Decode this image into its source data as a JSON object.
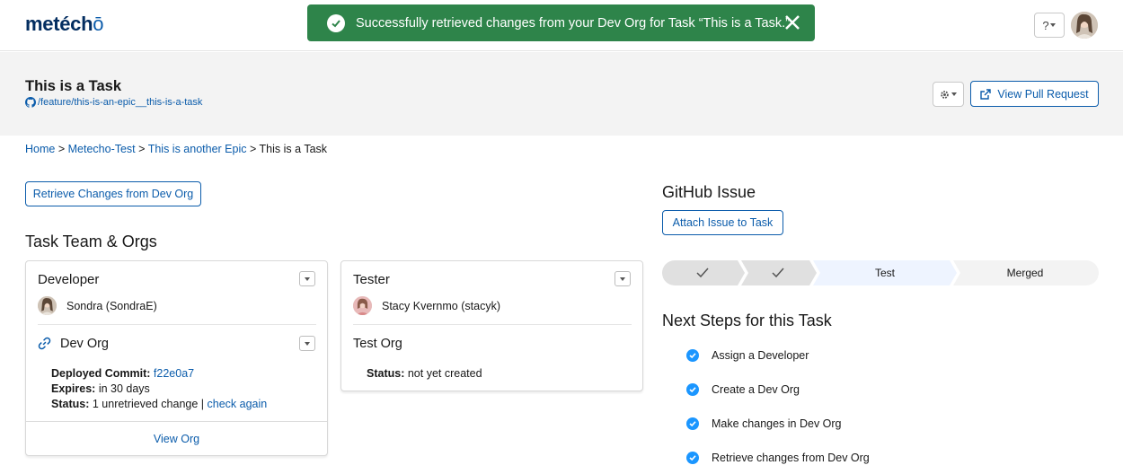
{
  "app": {
    "logo": "metecho"
  },
  "toast": {
    "message": "Successfully retrieved changes from your Dev Org for Task “This is a Task.”",
    "color": "#2e844a"
  },
  "header": {
    "help_label": "?",
    "title": "This is a Task",
    "branch": "/feature/this-is-an-epic__this-is-a-task",
    "view_pr_label": "View Pull Request"
  },
  "breadcrumb": {
    "home": "Home",
    "project": "Metecho-Test",
    "epic": "This is another Epic",
    "current": "This is a Task",
    "separator": ">"
  },
  "actions": {
    "retrieve_label": "Retrieve Changes from Dev Org"
  },
  "team": {
    "heading": "Task Team & Orgs",
    "developer": {
      "role": "Developer",
      "user": "Sondra (SondraE)",
      "org_title": "Dev Org",
      "commit_label": "Deployed Commit:",
      "commit": "f22e0a7",
      "expires_label": "Expires:",
      "expires": "in 30 days",
      "status_label": "Status:",
      "status": "1 unretrieved change |",
      "check_again": "check again",
      "view_org": "View Org"
    },
    "tester": {
      "role": "Tester",
      "user": "Stacy Kvernmo (stacyk)",
      "org_title": "Test Org",
      "status_label": "Status:",
      "status": "not yet created"
    }
  },
  "github": {
    "heading": "GitHub Issue",
    "attach_label": "Attach Issue to Task"
  },
  "path": {
    "stages": [
      "",
      "",
      "Test",
      "Merged"
    ],
    "completed": 2,
    "current_index": 2
  },
  "next_steps": {
    "heading": "Next Steps for this Task",
    "items": [
      "Assign a Developer",
      "Create a Dev Org",
      "Make changes in Dev Org",
      "Retrieve changes from Dev Org"
    ]
  },
  "colors": {
    "brand": "#0b5cab",
    "check": "#1b96ff",
    "path_done": "#e0e0e0",
    "path_current": "#eef4ff"
  }
}
